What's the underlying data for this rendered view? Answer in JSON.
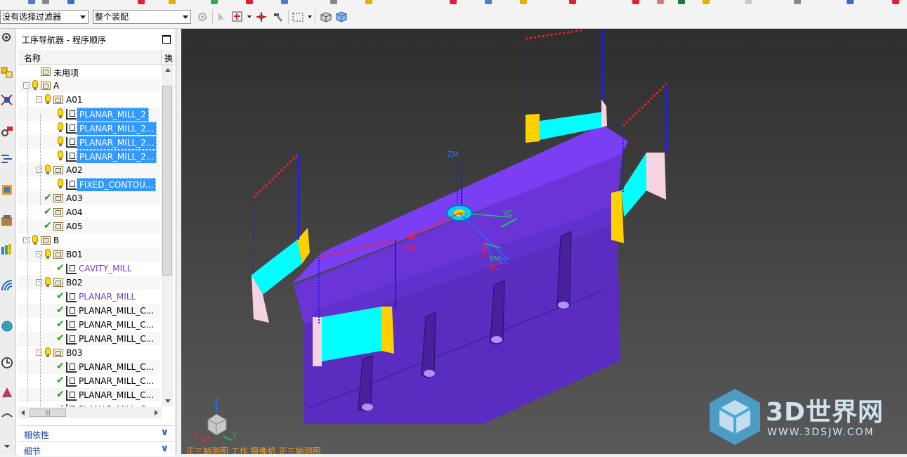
{
  "toolbar": {
    "filter_select": "没有选择过滤器",
    "assembly_select": "整个装配"
  },
  "navigator": {
    "title": "工序导航器 - 程序顺序",
    "columns": {
      "name": "名称",
      "extra": "换"
    },
    "rows": [
      {
        "label": "未用项",
        "kind": "folder",
        "depth": 0,
        "status": "none",
        "selected": false
      },
      {
        "label": "A",
        "kind": "folder",
        "depth": 0,
        "status": "bulb",
        "selected": false,
        "expand": true
      },
      {
        "label": "A01",
        "kind": "folder",
        "depth": 1,
        "status": "bulb",
        "selected": false,
        "expand": true
      },
      {
        "label": "PLANAR_MILL_2",
        "kind": "op",
        "depth": 2,
        "status": "bulb",
        "selected": true
      },
      {
        "label": "PLANAR_MILL_2...",
        "kind": "op",
        "depth": 2,
        "status": "bulb",
        "selected": true
      },
      {
        "label": "PLANAR_MILL_2...",
        "kind": "op",
        "depth": 2,
        "status": "bulb",
        "selected": true
      },
      {
        "label": "PLANAR_MILL_2...",
        "kind": "op",
        "depth": 2,
        "status": "bulb",
        "selected": true
      },
      {
        "label": "A02",
        "kind": "folder",
        "depth": 1,
        "status": "bulb",
        "selected": false,
        "expand": true
      },
      {
        "label": "FIXED_CONTOU...",
        "kind": "op",
        "depth": 2,
        "status": "bulb",
        "selected": true
      },
      {
        "label": "A03",
        "kind": "folder",
        "depth": 1,
        "status": "check",
        "selected": false
      },
      {
        "label": "A04",
        "kind": "folder",
        "depth": 1,
        "status": "check",
        "selected": false
      },
      {
        "label": "A05",
        "kind": "folder",
        "depth": 1,
        "status": "check",
        "selected": false
      },
      {
        "label": "B",
        "kind": "folder",
        "depth": 0,
        "status": "bulb",
        "selected": false,
        "expand": true
      },
      {
        "label": "B01",
        "kind": "folder",
        "depth": 1,
        "status": "bulb",
        "selected": false,
        "expand": true
      },
      {
        "label": "CAVITY_MILL",
        "kind": "op",
        "depth": 2,
        "status": "check",
        "selected": false,
        "purple": true
      },
      {
        "label": "B02",
        "kind": "folder",
        "depth": 1,
        "status": "bulb",
        "selected": false,
        "expand": true
      },
      {
        "label": "PLANAR_MILL",
        "kind": "op",
        "depth": 2,
        "status": "check",
        "selected": false,
        "purple": true
      },
      {
        "label": "PLANAR_MILL_C...",
        "kind": "op",
        "depth": 2,
        "status": "check",
        "selected": false
      },
      {
        "label": "PLANAR_MILL_C...",
        "kind": "op",
        "depth": 2,
        "status": "check",
        "selected": false
      },
      {
        "label": "PLANAR_MILL_C...",
        "kind": "op",
        "depth": 2,
        "status": "check",
        "selected": false
      },
      {
        "label": "B03",
        "kind": "folder",
        "depth": 1,
        "status": "bulb",
        "selected": false,
        "expand": true
      },
      {
        "label": "PLANAR_MILL_C...",
        "kind": "op",
        "depth": 2,
        "status": "check",
        "selected": false
      },
      {
        "label": "PLANAR_MILL_C...",
        "kind": "op",
        "depth": 2,
        "status": "check",
        "selected": false
      },
      {
        "label": "PLANAR_MILL_C...",
        "kind": "op",
        "depth": 2,
        "status": "check",
        "selected": false
      },
      {
        "label": "PLANAR_MILL_C...",
        "kind": "op",
        "depth": 2,
        "status": "check",
        "selected": false
      }
    ],
    "sections": {
      "dependencies": "相依性",
      "details": "细节"
    }
  },
  "viewport": {
    "view_info": "正三轴测图  工作  摄像机  正三轴测图",
    "axis_labels": {
      "zm": "ZM",
      "yc": "YC",
      "xm": "XM",
      "ym": "YM",
      "xc": "XC",
      "zc": "ZC"
    },
    "triad_labels": {
      "z": "Z",
      "x": "X",
      "y": "Y"
    },
    "colors": {
      "part": "#7a3ff2",
      "part_dark": "#5a2cc0",
      "cyan": "#00ffff",
      "yellow": "#ffd000",
      "pink": "#f7d3e2",
      "path_red": "#ff2020",
      "path_blue": "#1a1aff"
    }
  },
  "watermark": {
    "title": "3D世界网",
    "url": "WWW.3DSJW.COM"
  }
}
